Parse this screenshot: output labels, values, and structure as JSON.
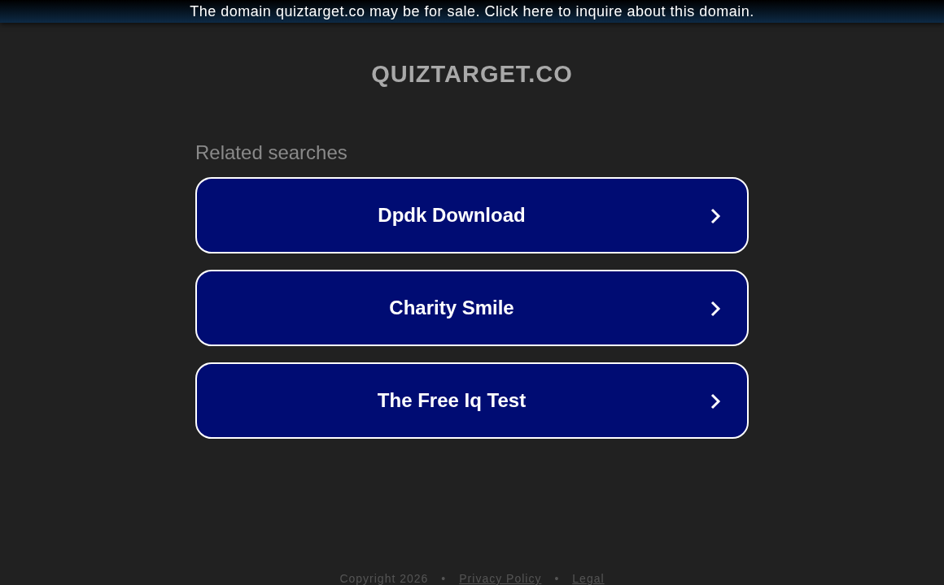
{
  "banner": {
    "text": "The domain quiztarget.co may be for sale. Click here to inquire about this domain."
  },
  "site_title": "QUIZTARGET.CO",
  "related_heading": "Related searches",
  "searches": [
    {
      "label": "Dpdk Download"
    },
    {
      "label": "Charity Smile"
    },
    {
      "label": "The Free Iq Test"
    }
  ],
  "footer": {
    "copyright": "Copyright 2026",
    "separators": [
      "•",
      "•"
    ],
    "links": [
      "Privacy Policy",
      "Legal"
    ]
  }
}
